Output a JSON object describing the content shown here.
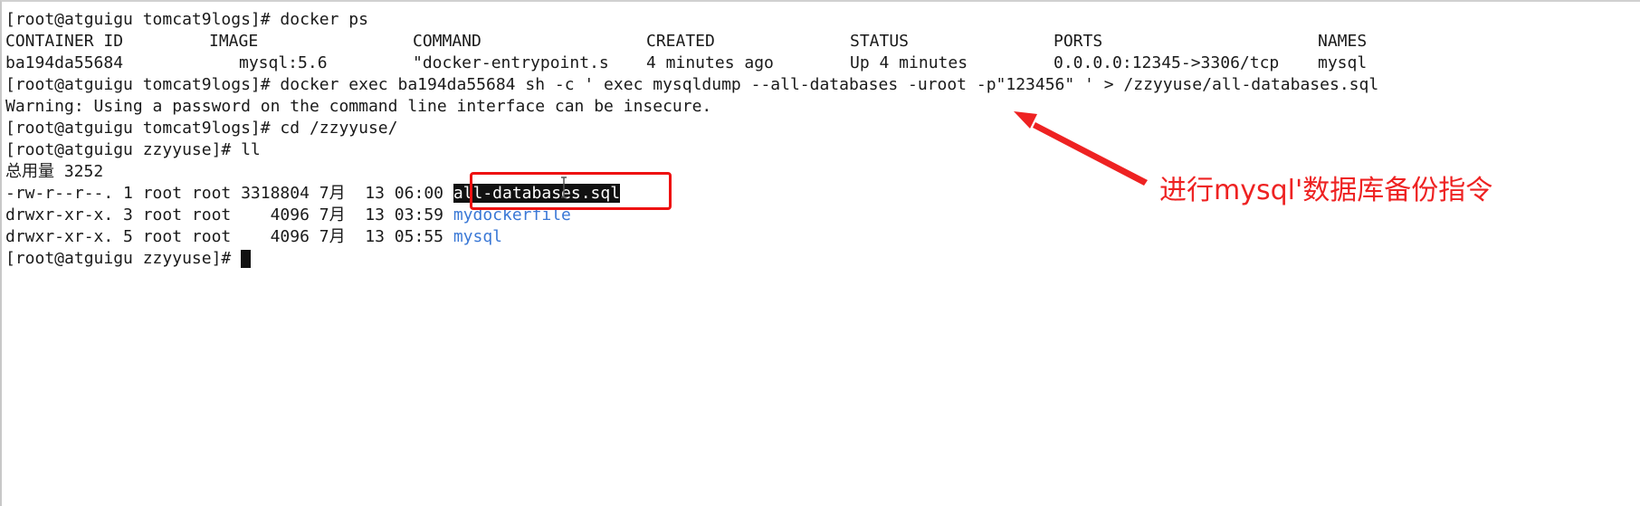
{
  "terminal": {
    "lines": [
      "[root@atguigu tomcat9logs]# docker ps",
      "[root@atguigu tomcat9logs]# docker exec ba194da55684 sh -c ' exec mysqldump --all-databases -uroot -p\"123456\" ' > /zzyyuse/all-databases.sql",
      "Warning: Using a password on the command line interface can be insecure.",
      "[root@atguigu tomcat9logs]# cd /zzyyuse/",
      "[root@atguigu zzyyuse]# ll",
      "总用量 3252",
      "-rw-r--r--. 1 root root 3318804 7月  13 06:00 ",
      "drwxr-xr-x. 3 root root    4096 7月  13 03:59 ",
      "drwxr-xr-x. 5 root root    4096 7月  13 05:55 ",
      "[root@atguigu zzyyuse]# "
    ],
    "docker_ps": {
      "headers": [
        "CONTAINER ID",
        "IMAGE",
        "COMMAND",
        "CREATED",
        "STATUS",
        "PORTS",
        "NAMES"
      ],
      "row": [
        "ba194da55684",
        "mysql:5.6",
        "\"docker-entrypoint.s",
        "4 minutes ago",
        "Up 4 minutes",
        "0.0.0.0:12345->3306/tcp",
        "mysql"
      ]
    },
    "files": {
      "selected_file": "all-databases.sql",
      "dir1": "mydockerfile",
      "dir2": "mysql"
    }
  },
  "annotation": {
    "text": "进行mysql'数据库备份指令",
    "color": "#ee2222"
  },
  "colors": {
    "directory": "#3a78d6",
    "highlight_box": "#ee1111"
  }
}
